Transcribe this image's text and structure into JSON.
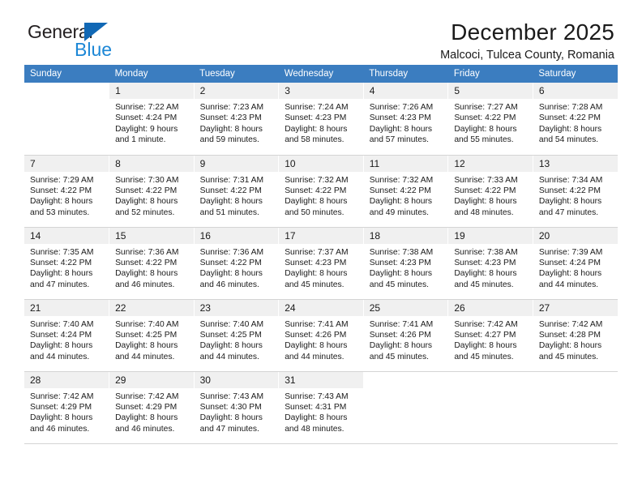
{
  "brand": {
    "name_part1": "General",
    "name_part2": "Blue",
    "logo_icon": "triangle-icon"
  },
  "header": {
    "title": "December 2025",
    "subtitle": "Malcoci, Tulcea County, Romania"
  },
  "calendar": {
    "weekday_headers": [
      "Sunday",
      "Monday",
      "Tuesday",
      "Wednesday",
      "Thursday",
      "Friday",
      "Saturday"
    ],
    "accent_color": "#3b7dc0",
    "daynum_bg": "#f0f0f0",
    "weeks": [
      [
        {
          "day": "",
          "sunrise": "",
          "sunset": "",
          "daylight1": "",
          "daylight2": ""
        },
        {
          "day": "1",
          "sunrise": "Sunrise: 7:22 AM",
          "sunset": "Sunset: 4:24 PM",
          "daylight1": "Daylight: 9 hours",
          "daylight2": "and 1 minute."
        },
        {
          "day": "2",
          "sunrise": "Sunrise: 7:23 AM",
          "sunset": "Sunset: 4:23 PM",
          "daylight1": "Daylight: 8 hours",
          "daylight2": "and 59 minutes."
        },
        {
          "day": "3",
          "sunrise": "Sunrise: 7:24 AM",
          "sunset": "Sunset: 4:23 PM",
          "daylight1": "Daylight: 8 hours",
          "daylight2": "and 58 minutes."
        },
        {
          "day": "4",
          "sunrise": "Sunrise: 7:26 AM",
          "sunset": "Sunset: 4:23 PM",
          "daylight1": "Daylight: 8 hours",
          "daylight2": "and 57 minutes."
        },
        {
          "day": "5",
          "sunrise": "Sunrise: 7:27 AM",
          "sunset": "Sunset: 4:22 PM",
          "daylight1": "Daylight: 8 hours",
          "daylight2": "and 55 minutes."
        },
        {
          "day": "6",
          "sunrise": "Sunrise: 7:28 AM",
          "sunset": "Sunset: 4:22 PM",
          "daylight1": "Daylight: 8 hours",
          "daylight2": "and 54 minutes."
        }
      ],
      [
        {
          "day": "7",
          "sunrise": "Sunrise: 7:29 AM",
          "sunset": "Sunset: 4:22 PM",
          "daylight1": "Daylight: 8 hours",
          "daylight2": "and 53 minutes."
        },
        {
          "day": "8",
          "sunrise": "Sunrise: 7:30 AM",
          "sunset": "Sunset: 4:22 PM",
          "daylight1": "Daylight: 8 hours",
          "daylight2": "and 52 minutes."
        },
        {
          "day": "9",
          "sunrise": "Sunrise: 7:31 AM",
          "sunset": "Sunset: 4:22 PM",
          "daylight1": "Daylight: 8 hours",
          "daylight2": "and 51 minutes."
        },
        {
          "day": "10",
          "sunrise": "Sunrise: 7:32 AM",
          "sunset": "Sunset: 4:22 PM",
          "daylight1": "Daylight: 8 hours",
          "daylight2": "and 50 minutes."
        },
        {
          "day": "11",
          "sunrise": "Sunrise: 7:32 AM",
          "sunset": "Sunset: 4:22 PM",
          "daylight1": "Daylight: 8 hours",
          "daylight2": "and 49 minutes."
        },
        {
          "day": "12",
          "sunrise": "Sunrise: 7:33 AM",
          "sunset": "Sunset: 4:22 PM",
          "daylight1": "Daylight: 8 hours",
          "daylight2": "and 48 minutes."
        },
        {
          "day": "13",
          "sunrise": "Sunrise: 7:34 AM",
          "sunset": "Sunset: 4:22 PM",
          "daylight1": "Daylight: 8 hours",
          "daylight2": "and 47 minutes."
        }
      ],
      [
        {
          "day": "14",
          "sunrise": "Sunrise: 7:35 AM",
          "sunset": "Sunset: 4:22 PM",
          "daylight1": "Daylight: 8 hours",
          "daylight2": "and 47 minutes."
        },
        {
          "day": "15",
          "sunrise": "Sunrise: 7:36 AM",
          "sunset": "Sunset: 4:22 PM",
          "daylight1": "Daylight: 8 hours",
          "daylight2": "and 46 minutes."
        },
        {
          "day": "16",
          "sunrise": "Sunrise: 7:36 AM",
          "sunset": "Sunset: 4:22 PM",
          "daylight1": "Daylight: 8 hours",
          "daylight2": "and 46 minutes."
        },
        {
          "day": "17",
          "sunrise": "Sunrise: 7:37 AM",
          "sunset": "Sunset: 4:23 PM",
          "daylight1": "Daylight: 8 hours",
          "daylight2": "and 45 minutes."
        },
        {
          "day": "18",
          "sunrise": "Sunrise: 7:38 AM",
          "sunset": "Sunset: 4:23 PM",
          "daylight1": "Daylight: 8 hours",
          "daylight2": "and 45 minutes."
        },
        {
          "day": "19",
          "sunrise": "Sunrise: 7:38 AM",
          "sunset": "Sunset: 4:23 PM",
          "daylight1": "Daylight: 8 hours",
          "daylight2": "and 45 minutes."
        },
        {
          "day": "20",
          "sunrise": "Sunrise: 7:39 AM",
          "sunset": "Sunset: 4:24 PM",
          "daylight1": "Daylight: 8 hours",
          "daylight2": "and 44 minutes."
        }
      ],
      [
        {
          "day": "21",
          "sunrise": "Sunrise: 7:40 AM",
          "sunset": "Sunset: 4:24 PM",
          "daylight1": "Daylight: 8 hours",
          "daylight2": "and 44 minutes."
        },
        {
          "day": "22",
          "sunrise": "Sunrise: 7:40 AM",
          "sunset": "Sunset: 4:25 PM",
          "daylight1": "Daylight: 8 hours",
          "daylight2": "and 44 minutes."
        },
        {
          "day": "23",
          "sunrise": "Sunrise: 7:40 AM",
          "sunset": "Sunset: 4:25 PM",
          "daylight1": "Daylight: 8 hours",
          "daylight2": "and 44 minutes."
        },
        {
          "day": "24",
          "sunrise": "Sunrise: 7:41 AM",
          "sunset": "Sunset: 4:26 PM",
          "daylight1": "Daylight: 8 hours",
          "daylight2": "and 44 minutes."
        },
        {
          "day": "25",
          "sunrise": "Sunrise: 7:41 AM",
          "sunset": "Sunset: 4:26 PM",
          "daylight1": "Daylight: 8 hours",
          "daylight2": "and 45 minutes."
        },
        {
          "day": "26",
          "sunrise": "Sunrise: 7:42 AM",
          "sunset": "Sunset: 4:27 PM",
          "daylight1": "Daylight: 8 hours",
          "daylight2": "and 45 minutes."
        },
        {
          "day": "27",
          "sunrise": "Sunrise: 7:42 AM",
          "sunset": "Sunset: 4:28 PM",
          "daylight1": "Daylight: 8 hours",
          "daylight2": "and 45 minutes."
        }
      ],
      [
        {
          "day": "28",
          "sunrise": "Sunrise: 7:42 AM",
          "sunset": "Sunset: 4:29 PM",
          "daylight1": "Daylight: 8 hours",
          "daylight2": "and 46 minutes."
        },
        {
          "day": "29",
          "sunrise": "Sunrise: 7:42 AM",
          "sunset": "Sunset: 4:29 PM",
          "daylight1": "Daylight: 8 hours",
          "daylight2": "and 46 minutes."
        },
        {
          "day": "30",
          "sunrise": "Sunrise: 7:43 AM",
          "sunset": "Sunset: 4:30 PM",
          "daylight1": "Daylight: 8 hours",
          "daylight2": "and 47 minutes."
        },
        {
          "day": "31",
          "sunrise": "Sunrise: 7:43 AM",
          "sunset": "Sunset: 4:31 PM",
          "daylight1": "Daylight: 8 hours",
          "daylight2": "and 48 minutes."
        },
        {
          "day": "",
          "sunrise": "",
          "sunset": "",
          "daylight1": "",
          "daylight2": ""
        },
        {
          "day": "",
          "sunrise": "",
          "sunset": "",
          "daylight1": "",
          "daylight2": ""
        },
        {
          "day": "",
          "sunrise": "",
          "sunset": "",
          "daylight1": "",
          "daylight2": ""
        }
      ]
    ]
  }
}
